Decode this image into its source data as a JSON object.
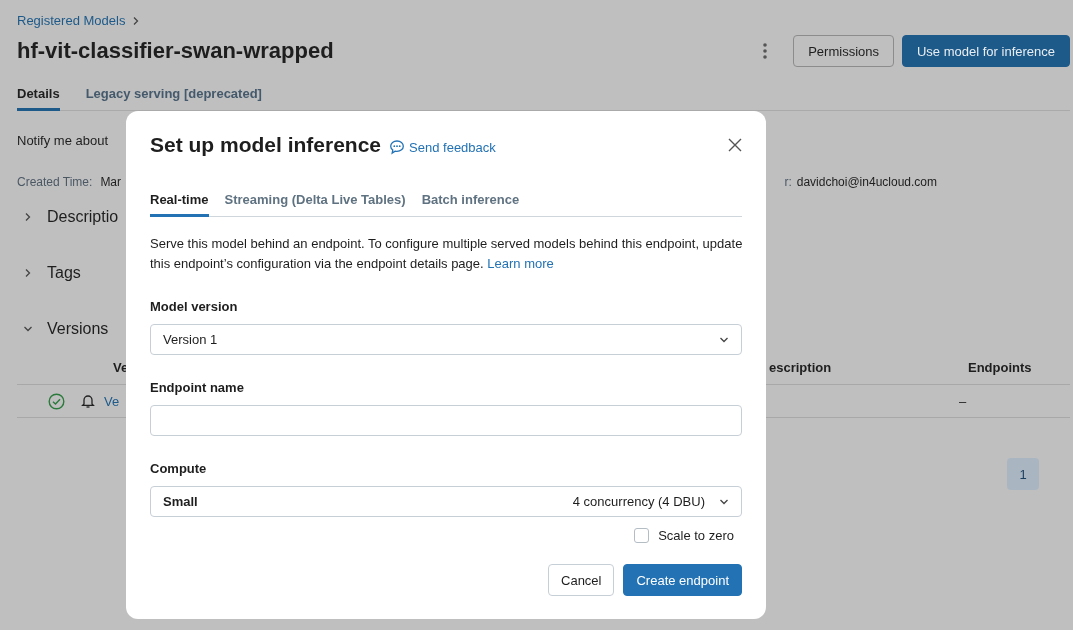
{
  "breadcrumb": {
    "label": "Registered Models"
  },
  "title": "hf-vit-classifier-swan-wrapped",
  "actions": [
    {
      "kind": "more"
    },
    {
      "kind": "secondary",
      "label": "Permissions"
    },
    {
      "kind": "primary",
      "label": "Use model for inference"
    }
  ],
  "tabs": [
    {
      "label": "Details",
      "selected": true
    },
    {
      "label": "Legacy serving [deprecated]",
      "selected": false
    }
  ],
  "notify_label": "Notify me about",
  "created_label": "Created Time:",
  "created_value": "Mar",
  "creator_label": "r:",
  "creator_value": "davidchoi@in4ucloud.com",
  "sections": [
    {
      "label": "Descriptio",
      "expanded": false
    },
    {
      "label": "Tags",
      "expanded": false
    },
    {
      "label": "Versions",
      "expanded": true
    }
  ],
  "table": {
    "columns": [
      "Ve",
      "escription",
      "Endpoints"
    ],
    "rows": [
      {
        "link": "Ve",
        "endpoints": "–"
      }
    ]
  },
  "pagination": [
    {
      "label": "1",
      "selected": true
    }
  ],
  "modal": {
    "title": "Set up model inference",
    "feedback": "Send feedback",
    "tabs": [
      {
        "label": "Real-time",
        "selected": true
      },
      {
        "label": "Streaming (Delta Live Tables)",
        "selected": false
      },
      {
        "label": "Batch inference",
        "selected": false
      }
    ],
    "description": "Serve this model behind an endpoint. To configure multiple served models behind this endpoint, update this endpoint’s configuration via the endpoint details page.",
    "learn_more": "Learn more",
    "fields": [
      {
        "kind": "select",
        "label": "Model version",
        "value": "Version 1"
      },
      {
        "kind": "text",
        "label": "Endpoint name"
      },
      {
        "kind": "compute",
        "label": "Compute",
        "value": "Small",
        "detail": "4 concurrency (4 DBU)"
      }
    ],
    "scale_to_zero": {
      "label": "Scale to zero",
      "checked": false
    },
    "buttons": [
      {
        "kind": "secondary",
        "label": "Cancel"
      },
      {
        "kind": "primary",
        "label": "Create endpoint"
      }
    ]
  }
}
